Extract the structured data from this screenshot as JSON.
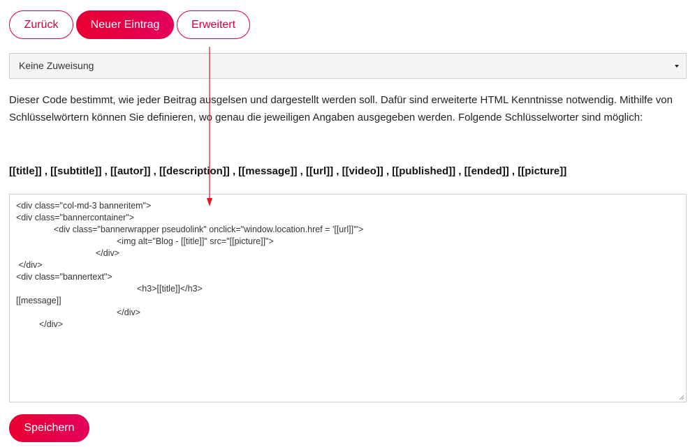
{
  "toolbar": {
    "back_label": "Zurück",
    "new_entry_label": "Neuer Eintrag",
    "advanced_label": "Erweitert"
  },
  "assignment_select": {
    "selected": "Keine Zuweisung"
  },
  "description": "Dieser Code bestimmt, wie jeder Beitrag ausgelsen und dargestellt werden soll. Dafür sind erweiterte HTML Kenntnisse notwendig. Mithilfe von Schlüsselwörtern können Sie definieren, wo genau die jeweiligen Angaben ausgegeben werden. Folgende Schlüsselworter sind möglich:",
  "keywords": "[[title]] , [[subtitle]] , [[autor]] , [[description]] , [[message]] , [[url]] , [[video]] , [[published]] , [[ended]] , [[picture]]",
  "code": {
    "lines": [
      "<div class=\"col-md-3 banneritem\">",
      "<div class=\"bannercontainer\">",
      "<div class=\"bannerwrapper pseudolink\" onclick=\"window.location.href = '[[url]]'\">",
      "<img alt=\"Blog - [[title]]\" src=\"[[picture]]\">",
      "</div>",
      " </div>",
      "<div class=\"bannertext\">",
      "<h3>[[title]]</h3>",
      "[[message]]",
      "</div>",
      "</div>"
    ]
  },
  "save_label": "Speichern",
  "colors": {
    "accent": "#d7003a",
    "annotation_arrow": "#e8141c"
  }
}
